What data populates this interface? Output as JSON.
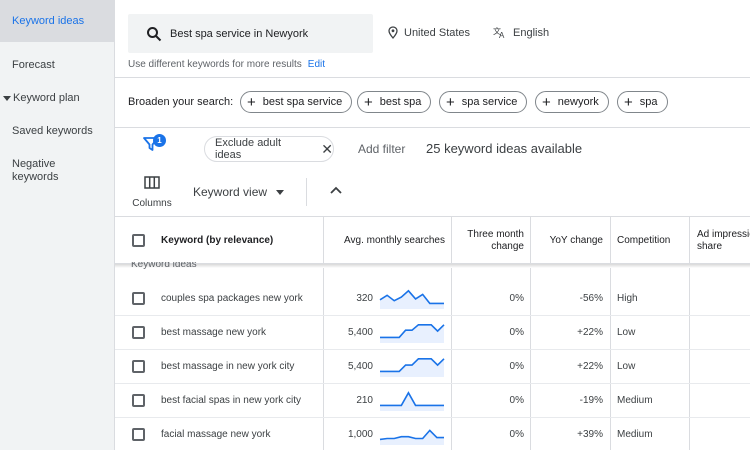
{
  "sidebar": {
    "items": [
      {
        "label": "Keyword ideas",
        "active": true
      },
      {
        "label": "Forecast"
      },
      {
        "label": "Keyword plan"
      },
      {
        "label": "Saved keywords"
      },
      {
        "label": "Negative keywords"
      }
    ]
  },
  "search": {
    "query": "Best spa service in Newyork",
    "location": "United States",
    "language": "English",
    "hint": "Use different keywords for more results",
    "edit_label": "Edit"
  },
  "broaden": {
    "label": "Broaden your search:",
    "chips": [
      "best spa service",
      "best spa",
      "spa service",
      "newyork",
      "spa"
    ]
  },
  "filters": {
    "badge_count": "1",
    "pill_label": "Exclude adult ideas",
    "add_filter": "Add filter",
    "available": "25 keyword ideas available"
  },
  "view": {
    "columns_label": "Columns",
    "keyword_view_label": "Keyword view"
  },
  "table": {
    "headers": {
      "keyword": "Keyword (by relevance)",
      "avg": "Avg. monthly searches",
      "three_month": "Three month change",
      "yoy": "YoY change",
      "competition": "Competition",
      "ad": "Ad impression share"
    },
    "group_label": "Keyword ideas",
    "rows": [
      {
        "keyword": "couples spa packages new york",
        "avg": "320",
        "three_month": "0%",
        "yoy": "-56%",
        "competition": "High",
        "trend": [
          40,
          65,
          35,
          55,
          90,
          45,
          70,
          20,
          20,
          20
        ]
      },
      {
        "keyword": "best massage new york",
        "avg": "5,400",
        "three_month": "0%",
        "yoy": "+22%",
        "competition": "Low",
        "trend": [
          20,
          20,
          20,
          20,
          60,
          60,
          90,
          90,
          90,
          55,
          90
        ]
      },
      {
        "keyword": "best massage in new york city",
        "avg": "5,400",
        "three_month": "0%",
        "yoy": "+22%",
        "competition": "Low",
        "trend": [
          20,
          20,
          20,
          20,
          55,
          55,
          90,
          90,
          90,
          55,
          90
        ]
      },
      {
        "keyword": "best facial spas in new york city",
        "avg": "210",
        "three_month": "0%",
        "yoy": "-19%",
        "competition": "Medium",
        "trend": [
          20,
          20,
          20,
          20,
          90,
          20,
          20,
          20,
          20,
          20
        ]
      },
      {
        "keyword": "facial massage new york",
        "avg": "1,000",
        "three_month": "0%",
        "yoy": "+39%",
        "competition": "Medium",
        "trend": [
          20,
          25,
          25,
          35,
          35,
          25,
          25,
          70,
          30,
          30
        ]
      }
    ]
  },
  "colors": {
    "accent": "#1a73e8",
    "trend_line": "#1a73e8",
    "trend_fill": "#e8f0fe"
  }
}
